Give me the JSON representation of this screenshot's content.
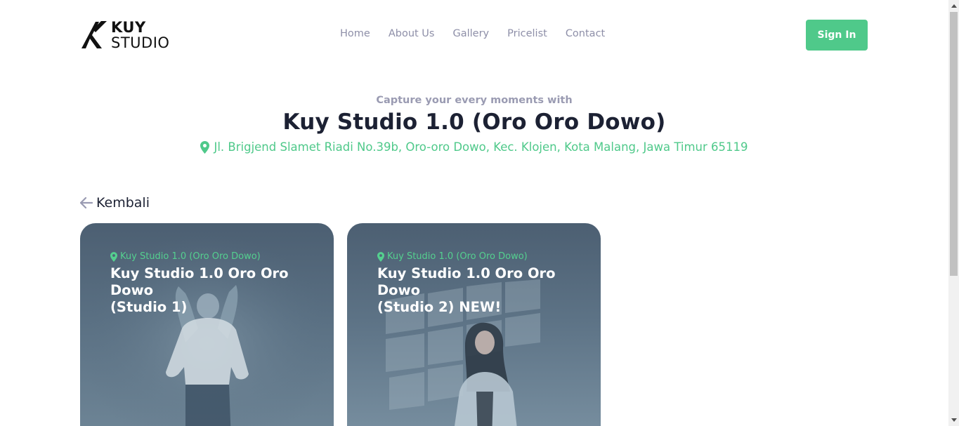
{
  "brand": {
    "line1": "KUY",
    "line2": "STUDIO"
  },
  "nav": {
    "items": [
      {
        "label": "Home"
      },
      {
        "label": "About Us"
      },
      {
        "label": "Gallery"
      },
      {
        "label": "Pricelist"
      },
      {
        "label": "Contact"
      }
    ]
  },
  "header": {
    "signin_label": "Sign In"
  },
  "hero": {
    "tagline": "Capture your every moments with",
    "title": "Kuy Studio 1.0 (Oro Oro Dowo)",
    "address": "Jl. Brigjend Slamet Riadi No.39b, Oro-oro Dowo, Kec. Klojen, Kota Malang, Jawa Timur 65119",
    "address_icon": "map-pin-icon"
  },
  "back": {
    "label": "Kembali",
    "icon": "arrow-left-icon"
  },
  "cards": [
    {
      "location": "Kuy Studio 1.0 (Oro Oro Dowo)",
      "title_line1": "Kuy Studio 1.0 Oro Oro Dowo",
      "title_line2": "(Studio 1)"
    },
    {
      "location": "Kuy Studio 1.0 (Oro Oro Dowo)",
      "title_line1": "Kuy Studio 1.0 Oro Oro Dowo",
      "title_line2": "(Studio 2) NEW!"
    }
  ],
  "colors": {
    "accent": "#4fc98a",
    "muted": "#9a9bb2",
    "dark": "#1c2133"
  }
}
